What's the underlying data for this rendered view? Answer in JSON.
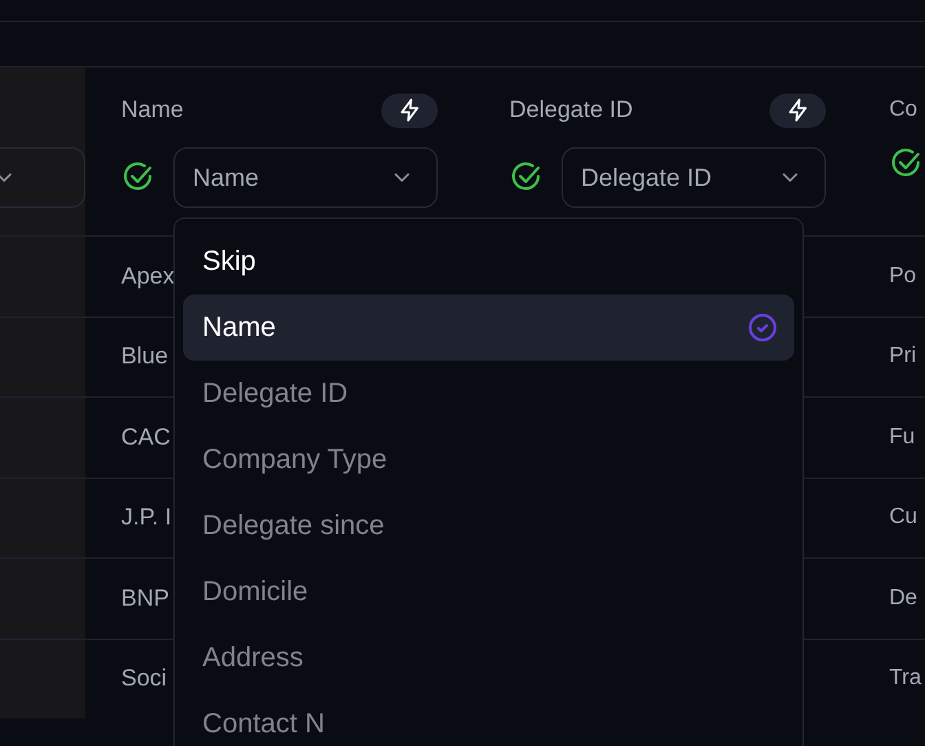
{
  "columns": [
    {
      "label": "Name",
      "mapped": true,
      "select": {
        "value": "Name"
      },
      "cells": [
        "Apex",
        "Blue",
        "CAC",
        "J.P. I",
        "BNP",
        "Soci"
      ]
    },
    {
      "label": "Delegate ID",
      "mapped": true,
      "select": {
        "value": "Delegate ID"
      }
    },
    {
      "label": "Co",
      "mapped": true,
      "cells": [
        "Po",
        "Pri",
        "Fu",
        "Cu",
        "De",
        "Tra"
      ]
    }
  ],
  "dropdown": {
    "items": [
      {
        "label": "Skip",
        "selected": false,
        "disabled": false
      },
      {
        "label": "Name",
        "selected": true,
        "disabled": false
      },
      {
        "label": "Delegate ID",
        "selected": false,
        "disabled": true
      },
      {
        "label": "Company Type",
        "selected": false,
        "disabled": true
      },
      {
        "label": "Delegate since",
        "selected": false,
        "disabled": true
      },
      {
        "label": "Domicile",
        "selected": false,
        "disabled": true
      },
      {
        "label": "Address",
        "selected": false,
        "disabled": true
      },
      {
        "label": "Contact N",
        "selected": false,
        "disabled": true
      }
    ]
  }
}
